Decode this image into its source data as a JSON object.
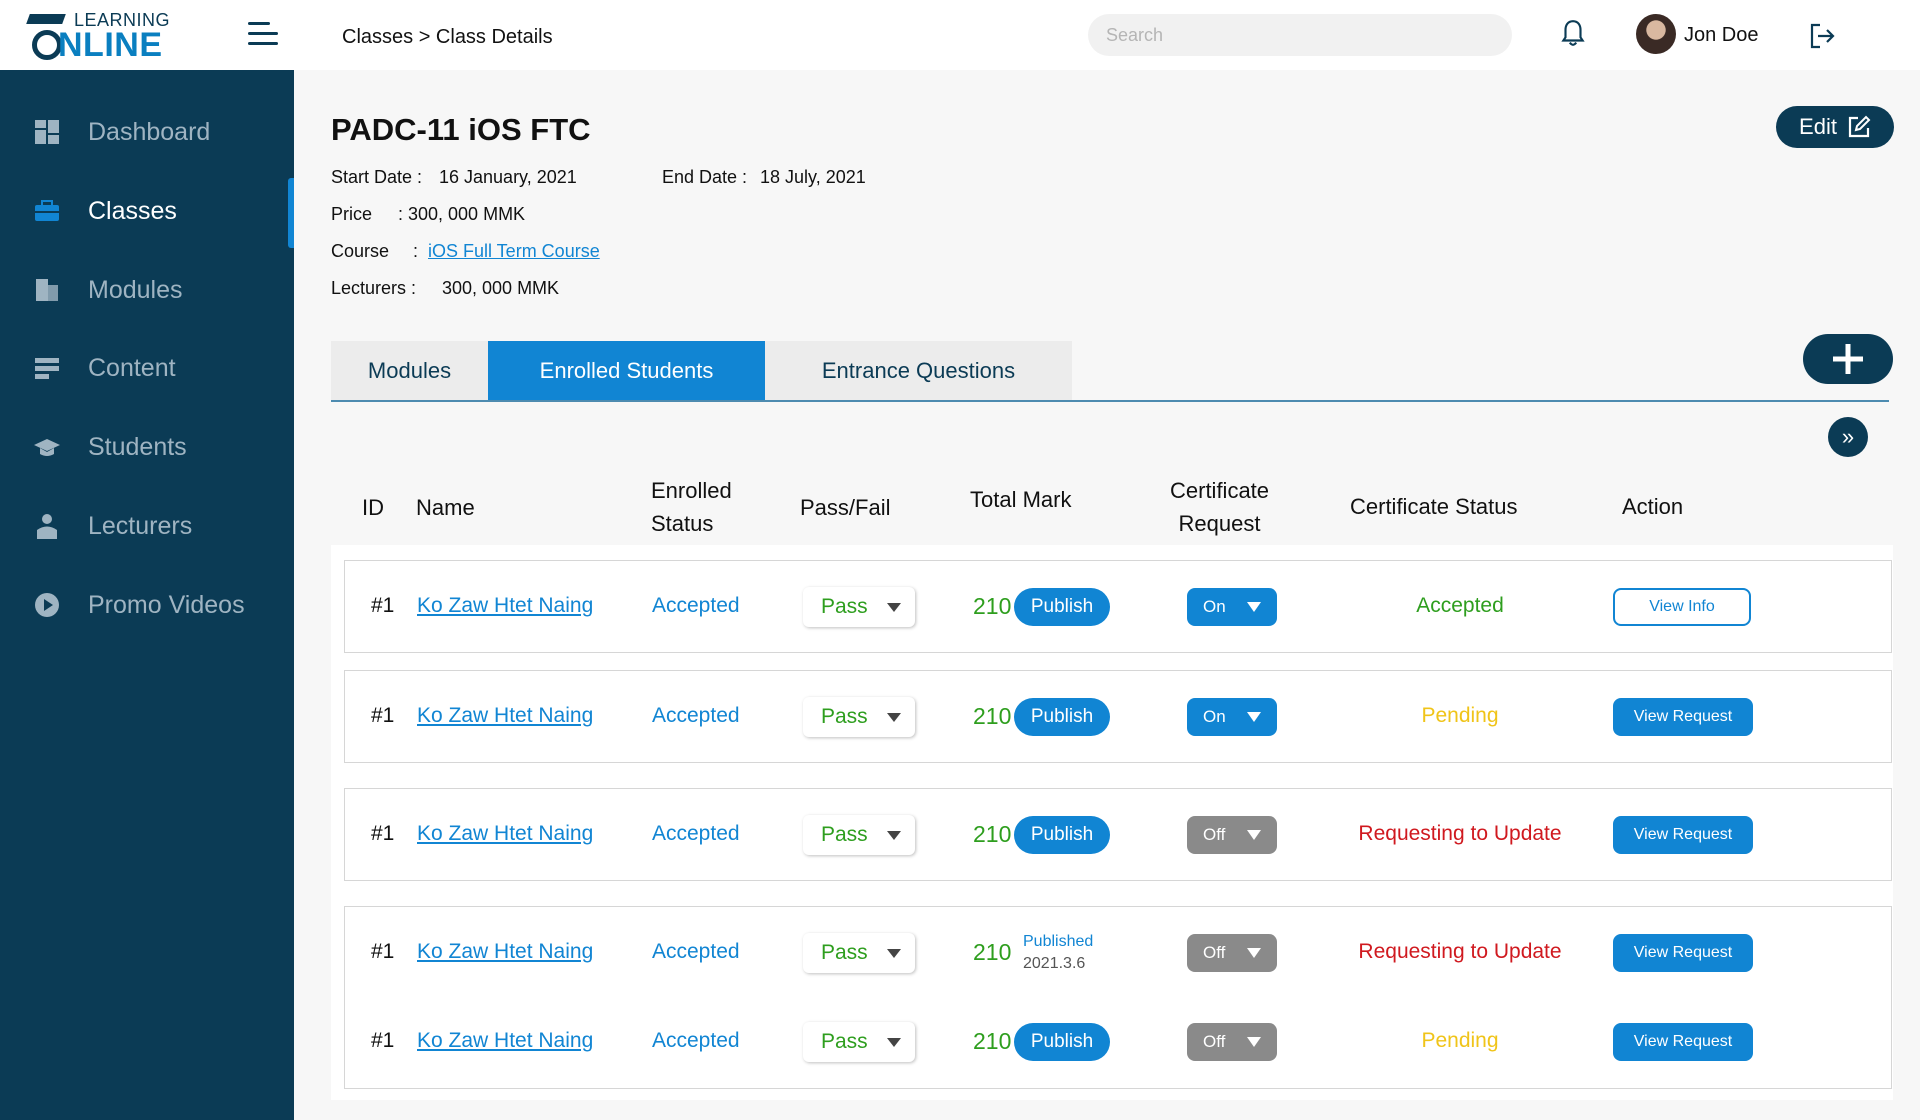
{
  "brand": {
    "logo_top": "LEARNING",
    "logo_main": "NLINE",
    "primary_color": "#0b3b55",
    "accent_color": "#1185d3"
  },
  "header": {
    "breadcrumb": "Classes > Class Details",
    "search_placeholder": "Search",
    "user_name": "Jon Doe",
    "icons": [
      "menu-icon",
      "bell-icon",
      "avatar",
      "logout-icon"
    ]
  },
  "sidebar": {
    "items": [
      {
        "label": "Dashboard",
        "icon": "dashboard-icon",
        "active": false
      },
      {
        "label": "Classes",
        "icon": "briefcase-icon",
        "active": true
      },
      {
        "label": "Modules",
        "icon": "modules-icon",
        "active": false
      },
      {
        "label": "Content",
        "icon": "content-icon",
        "active": false
      },
      {
        "label": "Students",
        "icon": "graduation-cap-icon",
        "active": false
      },
      {
        "label": "Lecturers",
        "icon": "lecturer-icon",
        "active": false
      },
      {
        "label": "Promo Videos",
        "icon": "play-icon",
        "active": false
      }
    ]
  },
  "class": {
    "title": "PADC-11 iOS FTC",
    "edit_label": "Edit",
    "start_label": "Start Date :",
    "start_value": "16 January, 2021",
    "end_label": "End Date :",
    "end_value": "18 July, 2021",
    "price_label": "Price",
    "price_value": ": 300, 000 MMK",
    "course_label": "Course",
    "course_sep": ":",
    "course_value": "iOS Full Term Course",
    "lecturers_label": "Lecturers :",
    "lecturers_value": "300, 000 MMK"
  },
  "tabs": [
    {
      "label": "Modules",
      "active": false
    },
    {
      "label": "Enrolled Students",
      "active": true
    },
    {
      "label": "Entrance Questions",
      "active": false
    }
  ],
  "table": {
    "headers": {
      "id": "ID",
      "name": "Name",
      "enrolled_1": "Enrolled",
      "enrolled_2": "Status",
      "passfail": "Pass/Fail",
      "total": "Total Mark",
      "cert_req_1": "Certificate",
      "cert_req_2": "Request",
      "cert_status": "Certificate Status",
      "action": "Action"
    },
    "rows": [
      {
        "id": "#1",
        "name": "Ko Zaw Htet Naing",
        "status": "Accepted",
        "pass": "Pass",
        "mark": "210",
        "publish": "Publish",
        "published_label": "",
        "published_date": "",
        "cert_request": "On",
        "cert_status": "Accepted",
        "cert_status_color": "#2e9e1e",
        "action": "View Info",
        "action_style": "outline"
      },
      {
        "id": "#1",
        "name": "Ko Zaw Htet Naing",
        "status": "Accepted",
        "pass": "Pass",
        "mark": "210",
        "publish": "Publish",
        "published_label": "",
        "published_date": "",
        "cert_request": "On",
        "cert_status": "Pending",
        "cert_status_color": "#f0c419",
        "action": "View Request",
        "action_style": "solid"
      },
      {
        "id": "#1",
        "name": "Ko Zaw Htet Naing",
        "status": "Accepted",
        "pass": "Pass",
        "mark": "210",
        "publish": "Publish",
        "published_label": "",
        "published_date": "",
        "cert_request": "Off",
        "cert_status": "Requesting to Update",
        "cert_status_color": "#d0191f",
        "action": "View Request",
        "action_style": "solid"
      },
      {
        "id": "#1",
        "name": "Ko Zaw Htet Naing",
        "status": "Accepted",
        "pass": "Pass",
        "mark": "210",
        "publish": "",
        "published_label": "Published",
        "published_date": "2021.3.6",
        "cert_request": "Off",
        "cert_status": "Requesting to Update",
        "cert_status_color": "#d0191f",
        "action": "View Request",
        "action_style": "solid"
      },
      {
        "id": "#1",
        "name": "Ko Zaw Htet Naing",
        "status": "Accepted",
        "pass": "Pass",
        "mark": "210",
        "publish": "Publish",
        "published_label": "",
        "published_date": "",
        "cert_request": "Off",
        "cert_status": "Pending",
        "cert_status_color": "#f0c419",
        "action": "View Request",
        "action_style": "solid"
      }
    ]
  }
}
